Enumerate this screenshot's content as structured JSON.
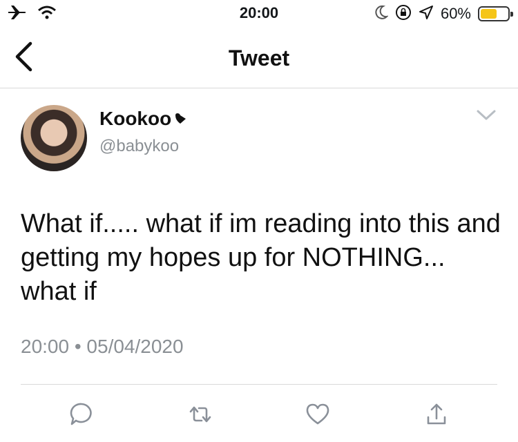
{
  "status_bar": {
    "time": "20:00",
    "battery_percent": "60%",
    "battery_level": 0.6,
    "battery_color": "#f5c518",
    "left_icons": [
      "airplane-icon",
      "wifi-icon"
    ],
    "right_icons": [
      "moon-icon",
      "orientation-lock-icon",
      "location-icon",
      "battery-icon"
    ]
  },
  "header": {
    "title": "Tweet",
    "back_icon": "chevron-left-icon"
  },
  "tweet": {
    "author_name": "Kookoo",
    "author_handle": "@babykoo",
    "text": "What if..... what if im reading into this and getting my hopes up for NOTHING... what if",
    "timestamp": "20:00 • 05/04/2020",
    "more_icon": "chevron-down-icon"
  },
  "actions": [
    "reply-icon",
    "retweet-icon",
    "like-icon",
    "share-icon"
  ]
}
